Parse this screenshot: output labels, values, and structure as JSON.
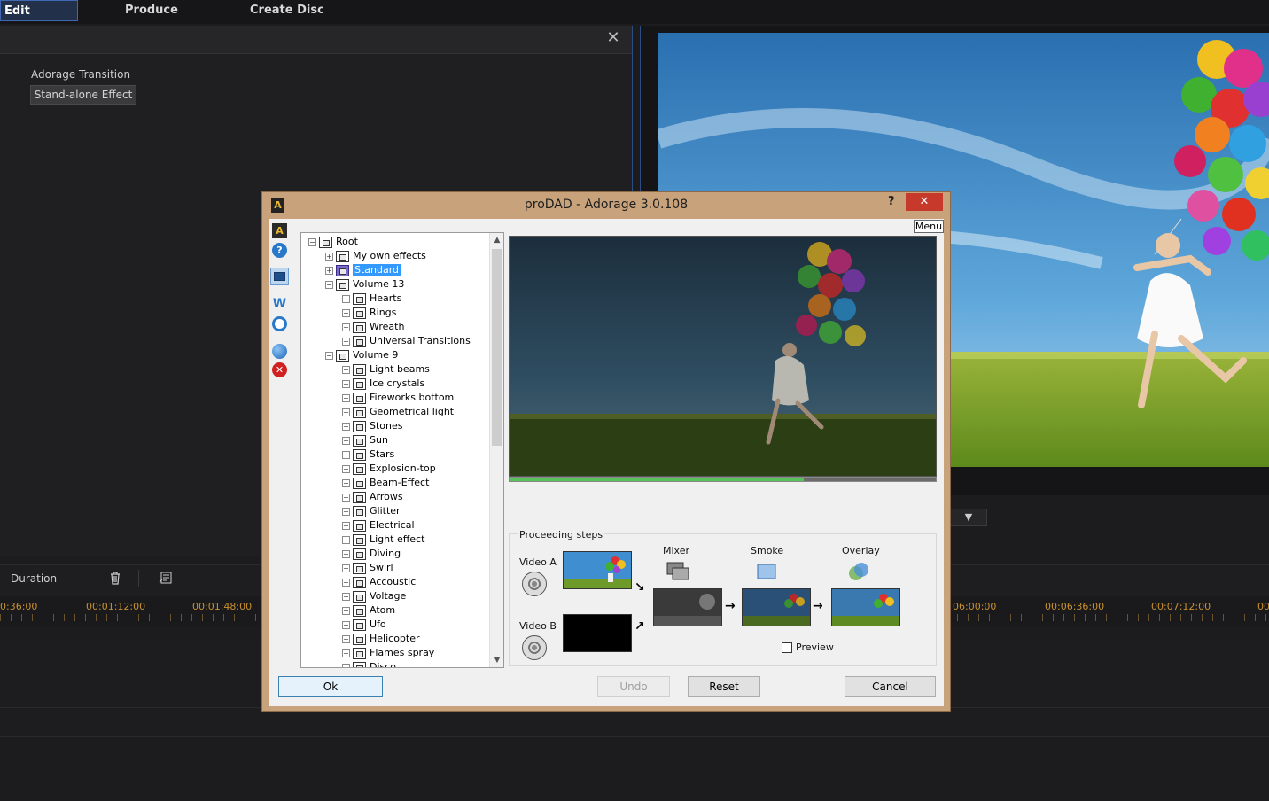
{
  "top_tabs": [
    {
      "label": "Edit"
    },
    {
      "label": "Produce"
    },
    {
      "label": "Create Disc"
    }
  ],
  "left_panel": {
    "effect_type": "Adorage Transition",
    "mode_button": "Stand-alone Effect",
    "close_icon": "close-icon"
  },
  "timeline": {
    "duration_label": "Duration",
    "icons": [
      "trash-icon",
      "edit-icon"
    ],
    "ticks": [
      "0:36:00",
      "00:01:12:00",
      "00:01:48:00",
      "06:00:00",
      "00:06:36:00",
      "00:07:12:00",
      "00"
    ]
  },
  "dialog": {
    "title": "proDAD - Adorage 3.0.108",
    "help": "?",
    "close": "✕",
    "menu": "Menu",
    "tree": [
      {
        "label": "Root",
        "level": 0,
        "expanded": true
      },
      {
        "label": "My own effects",
        "level": 1
      },
      {
        "label": "Standard",
        "level": 1,
        "selected": true
      },
      {
        "label": "Volume 13",
        "level": 1,
        "expanded": true
      },
      {
        "label": "Hearts",
        "level": 2
      },
      {
        "label": "Rings",
        "level": 2
      },
      {
        "label": "Wreath",
        "level": 2
      },
      {
        "label": "Universal Transitions",
        "level": 2
      },
      {
        "label": "Volume 9",
        "level": 1,
        "expanded": true
      },
      {
        "label": "Light beams",
        "level": 2
      },
      {
        "label": "Ice crystals",
        "level": 2
      },
      {
        "label": "Fireworks bottom",
        "level": 2
      },
      {
        "label": "Geometrical light",
        "level": 2
      },
      {
        "label": "Stones",
        "level": 2
      },
      {
        "label": "Sun",
        "level": 2
      },
      {
        "label": "Stars",
        "level": 2
      },
      {
        "label": "Explosion-top",
        "level": 2
      },
      {
        "label": "Beam-Effect",
        "level": 2
      },
      {
        "label": "Arrows",
        "level": 2
      },
      {
        "label": "Glitter",
        "level": 2
      },
      {
        "label": "Electrical",
        "level": 2
      },
      {
        "label": "Light effect",
        "level": 2
      },
      {
        "label": "Diving",
        "level": 2
      },
      {
        "label": "Swirl",
        "level": 2
      },
      {
        "label": "Accoustic",
        "level": 2
      },
      {
        "label": "Voltage",
        "level": 2
      },
      {
        "label": "Atom",
        "level": 2
      },
      {
        "label": "Ufo",
        "level": 2
      },
      {
        "label": "Helicopter",
        "level": 2
      },
      {
        "label": "Flames spray",
        "level": 2
      },
      {
        "label": "Disco",
        "level": 2
      }
    ],
    "playback_progress": 0.69,
    "steps": {
      "title": "Proceeding steps",
      "video_a": "Video A",
      "video_b": "Video B",
      "mixer": "Mixer",
      "smoke": "Smoke",
      "overlay": "Overlay",
      "preview_label": "Preview",
      "preview_checked": false
    },
    "buttons": {
      "ok": "Ok",
      "undo": "Undo",
      "reset": "Reset",
      "cancel": "Cancel"
    }
  }
}
